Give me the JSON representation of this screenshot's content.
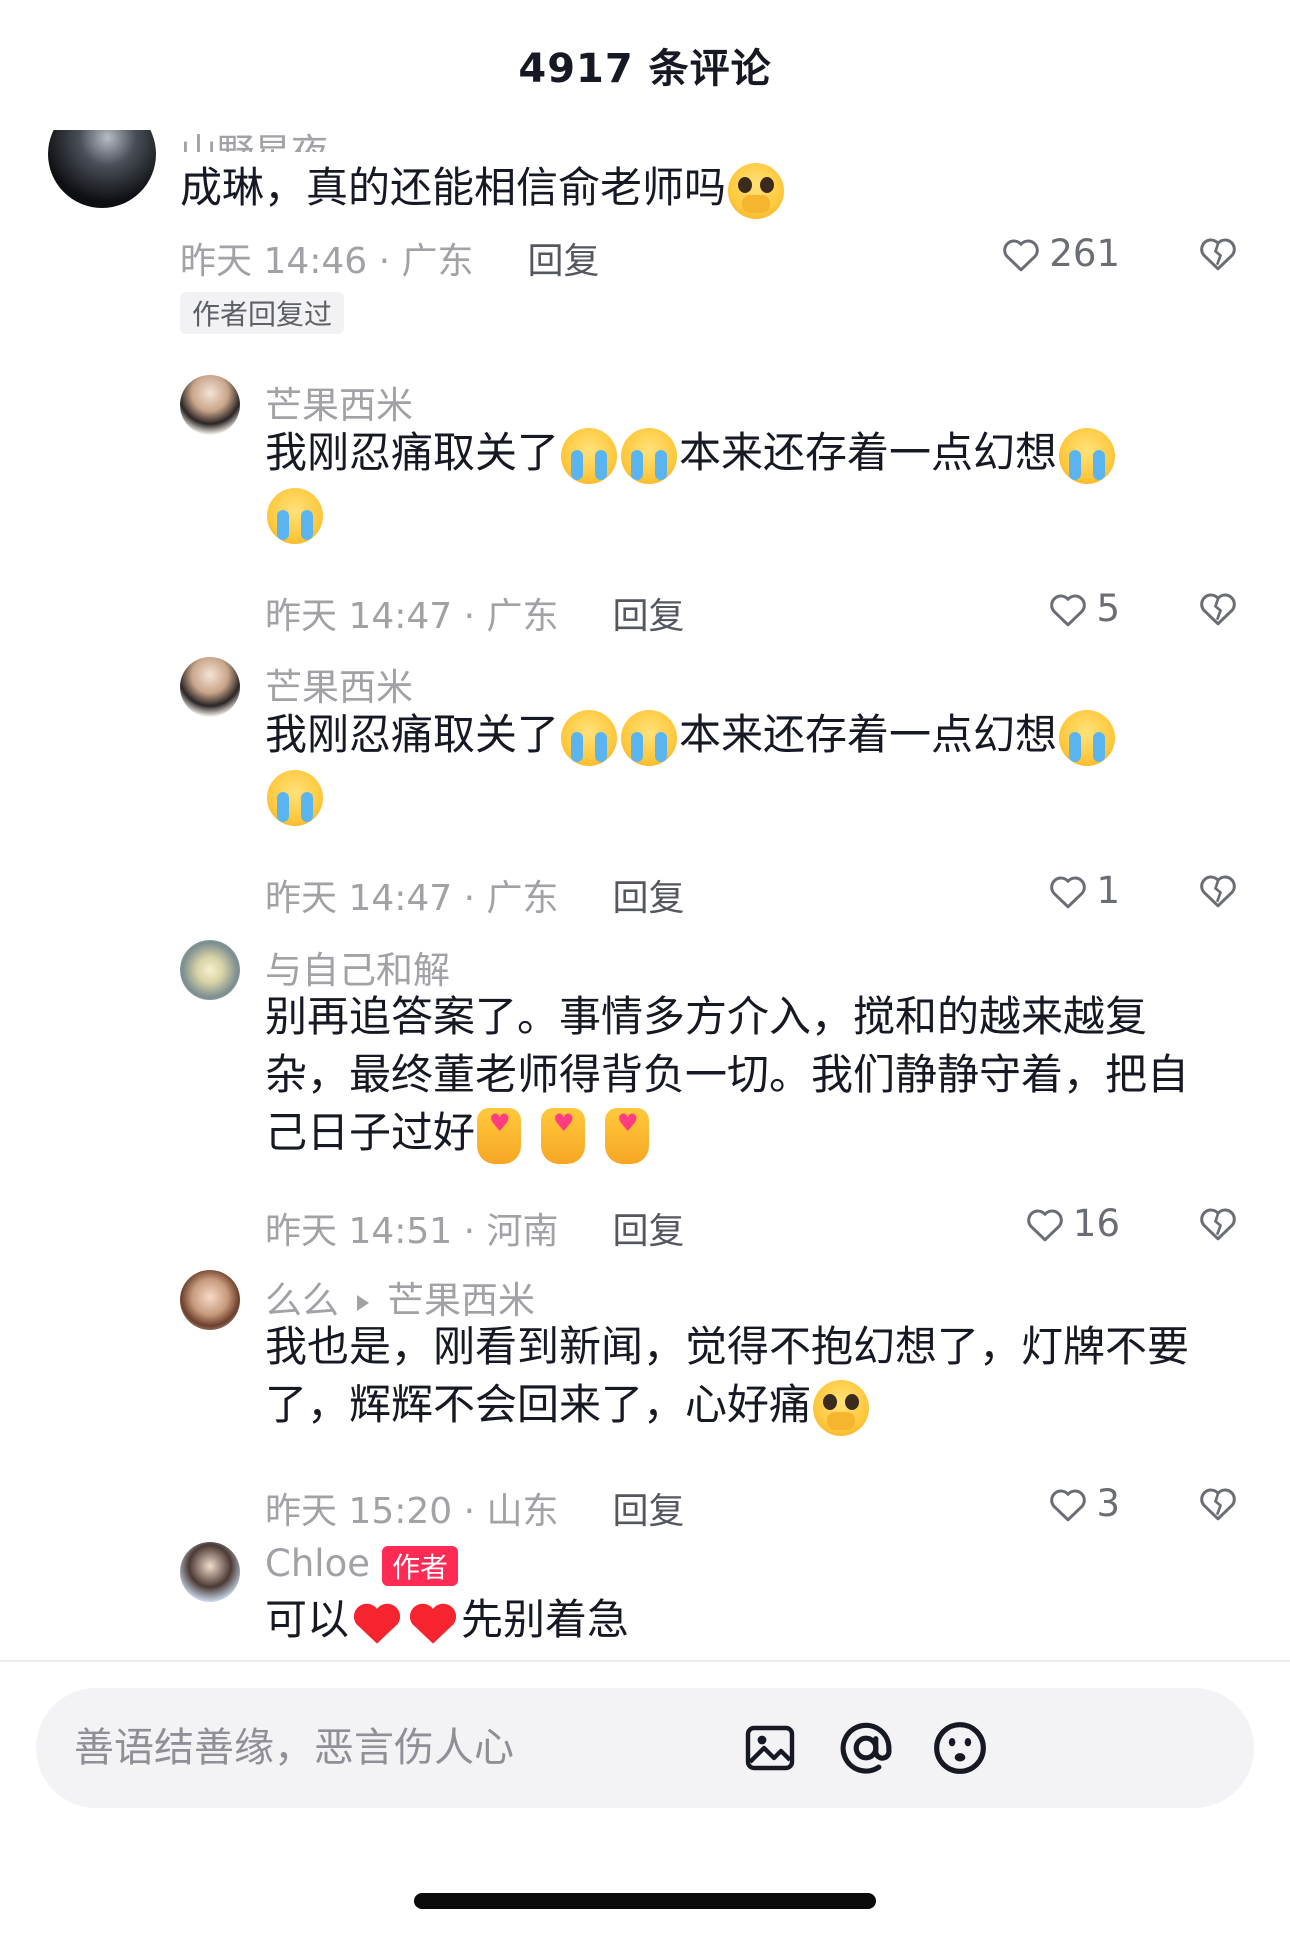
{
  "header": {
    "title": "4917 条评论"
  },
  "main_comment": {
    "username": "山野星夜",
    "text": "成琳，真的还能相信俞老师吗",
    "time_location": "昨天 14:46 · 广东",
    "reply_label": "回复",
    "likes": "261",
    "author_replied": "作者回复过"
  },
  "replies": [
    {
      "username": "芒果西米",
      "text_a": "我刚忍痛取关了",
      "text_b": "本来还存着一点幻想",
      "time_location": "昨天 14:47 · 广东",
      "reply_label": "回复",
      "likes": "5"
    },
    {
      "username": "芒果西米",
      "text_a": "我刚忍痛取关了",
      "text_b": "本来还存着一点幻想",
      "time_location": "昨天 14:47 · 广东",
      "reply_label": "回复",
      "likes": "1"
    },
    {
      "username": "与自己和解",
      "text": "别再追答案了。事情多方介入，搅和的越来越复杂，最终董老师得背负一切。我们静静守着，把自己日子过好",
      "time_location": "昨天 14:51 · 河南",
      "reply_label": "回复",
      "likes": "16"
    },
    {
      "username": "么么",
      "reply_to": "芒果西米",
      "text": "我也是，刚看到新闻，觉得不抱幻想了，灯牌不要了，辉辉不会回来了，心好痛",
      "time_location": "昨天 15:20 · 山东",
      "reply_label": "回复",
      "likes": "3"
    },
    {
      "username": "Chloe",
      "badge": "作者",
      "text_a": "可以",
      "text_b": "先别着急"
    }
  ],
  "input": {
    "placeholder": "善语结善缘，恶言伤人心"
  },
  "colors": {
    "accent": "#fe2c55",
    "muted": "#a1a1a6",
    "text": "#161823"
  },
  "icons": [
    "heart-icon",
    "dislike-icon",
    "image-icon",
    "at-icon",
    "emoji-icon"
  ]
}
